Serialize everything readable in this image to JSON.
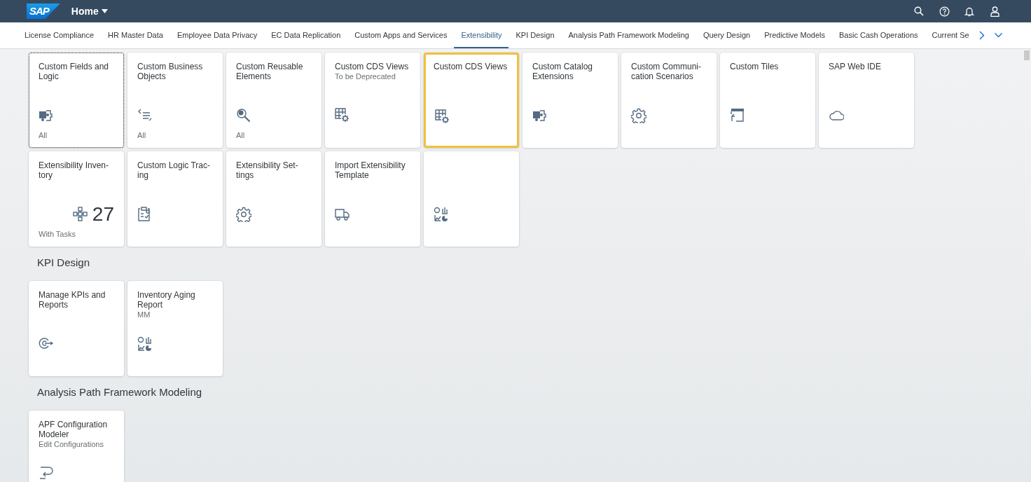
{
  "shell": {
    "logo": "SAP",
    "title": "Home"
  },
  "tabs": [
    {
      "label": "License Compliance",
      "selected": false
    },
    {
      "label": "HR Master Data",
      "selected": false
    },
    {
      "label": "Employee Data Privacy",
      "selected": false
    },
    {
      "label": "EC Data Replication",
      "selected": false
    },
    {
      "label": "Custom Apps and Services",
      "selected": false
    },
    {
      "label": "Extensibility",
      "selected": true
    },
    {
      "label": "KPI Design",
      "selected": false
    },
    {
      "label": "Analysis Path Framework Modeling",
      "selected": false
    },
    {
      "label": "Query Design",
      "selected": false
    },
    {
      "label": "Predictive Models",
      "selected": false
    },
    {
      "label": "Basic Cash Operations",
      "selected": false
    },
    {
      "label": "Current Se",
      "selected": false
    }
  ],
  "groups": [
    {
      "tiles": [
        {
          "title": "Custom Fields and Logic",
          "kind": "puzzle",
          "footer": "All",
          "focused": true,
          "highlighted": false
        },
        {
          "title": "Custom Business Objects",
          "kind": "list",
          "footer": "All",
          "focused": false,
          "highlighted": false
        },
        {
          "title": "Custom Reusable Elements",
          "kind": "search",
          "footer": "All",
          "focused": false,
          "highlighted": false
        },
        {
          "title": "Custom CDS Views",
          "subtitle": "To be Deprecated",
          "kind": "table",
          "focused": false,
          "highlighted": false
        },
        {
          "title": "Custom CDS Views",
          "kind": "table",
          "focused": false,
          "highlighted": true
        },
        {
          "title": "Custom Catalog Extensions",
          "kind": "puzzle",
          "focused": false,
          "highlighted": false
        },
        {
          "title": "Custom Communi-cation Scenarios",
          "kind": "settings",
          "focused": false,
          "highlighted": false
        },
        {
          "title": "Custom Tiles",
          "kind": "window",
          "focused": false,
          "highlighted": false
        },
        {
          "title": "SAP Web IDE",
          "kind": "cloud",
          "focused": false,
          "highlighted": false
        },
        {
          "title": "Extensibility Inven-tory",
          "kind": "network",
          "number": "27",
          "footer": "With Tasks",
          "focused": false,
          "highlighted": false
        },
        {
          "title": "Custom Logic Trac-ing",
          "kind": "checklist",
          "focused": false,
          "highlighted": false
        },
        {
          "title": "Extensibility Set-tings",
          "kind": "settings",
          "focused": false,
          "highlighted": false
        },
        {
          "title": "Import Extensibility Template",
          "kind": "truck",
          "focused": false,
          "highlighted": false
        },
        {
          "kind": "analytics",
          "focused": false,
          "highlighted": false
        }
      ]
    },
    {
      "title": "KPI Design",
      "tiles": [
        {
          "title": "Manage KPIs and Reports",
          "kind": "target",
          "focused": false,
          "highlighted": false
        },
        {
          "title": "Inventory Aging Report",
          "subtitle": "MM",
          "kind": "analytics",
          "focused": false,
          "highlighted": false
        }
      ]
    },
    {
      "title": "Analysis Path Framework Modeling",
      "tiles": [
        {
          "title": "APF Configuration Modeler",
          "subtitle": "Edit Configurations",
          "kind": "path",
          "focused": false,
          "highlighted": false
        }
      ]
    }
  ]
}
